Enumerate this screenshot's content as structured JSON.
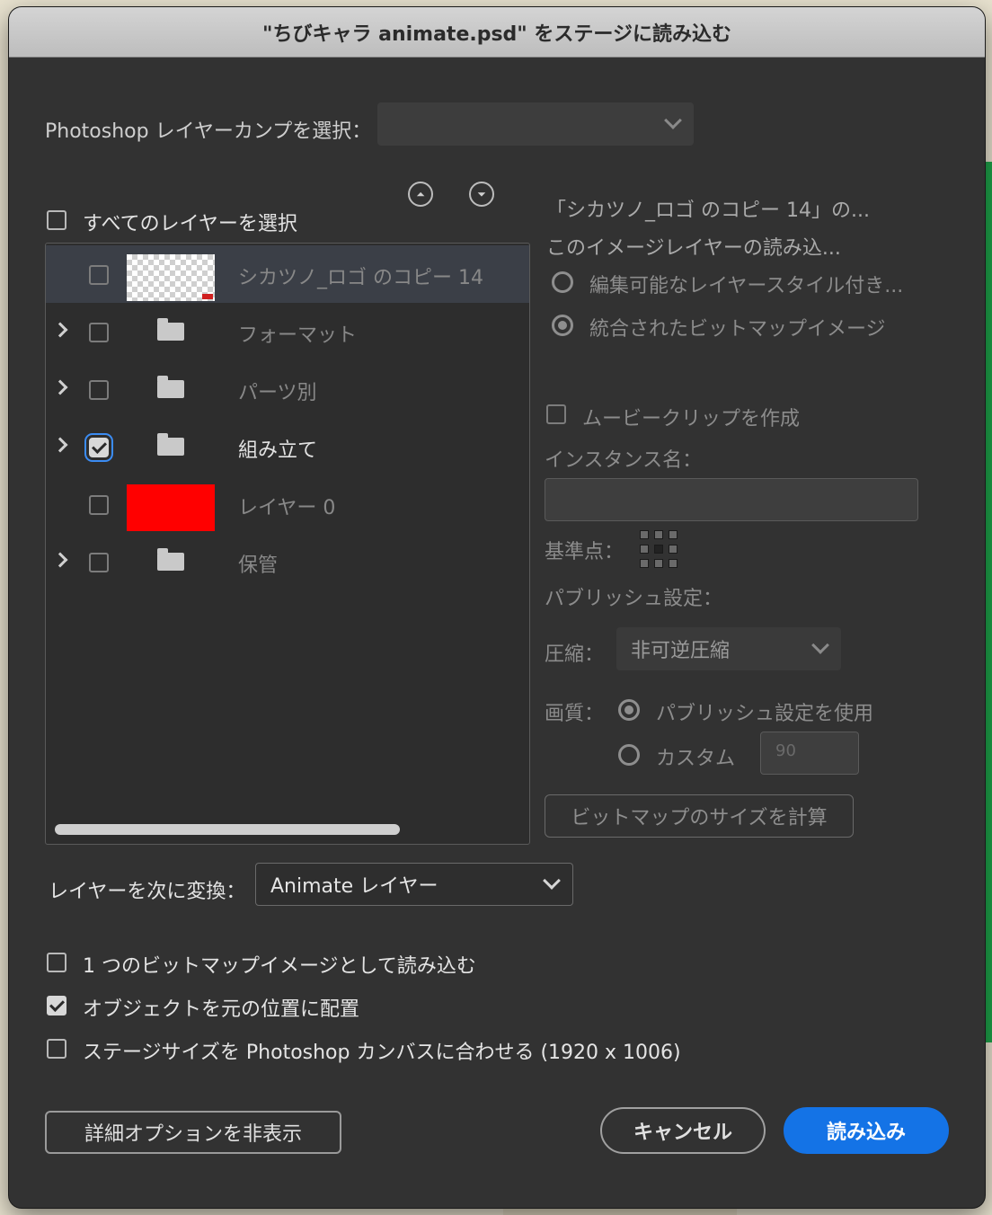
{
  "dialog": {
    "title": "\"ちびキャラ animate.psd\" をステージに読み込む"
  },
  "layer_comp": {
    "label": "Photoshop レイヤーカンプを選択：",
    "value": ""
  },
  "select_all": {
    "label": "すべてのレイヤーを選択",
    "checked": false
  },
  "layers": [
    {
      "name": "シカツノ_ロゴ のコピー 14",
      "type": "image",
      "thumbnail": "transparent-checker",
      "expandable": false,
      "checked": false,
      "selected": true
    },
    {
      "name": "フォーマット",
      "type": "folder",
      "expandable": true,
      "checked": false,
      "selected": false
    },
    {
      "name": "パーツ別",
      "type": "folder",
      "expandable": true,
      "checked": false,
      "selected": false
    },
    {
      "name": "組み立て",
      "type": "folder",
      "expandable": true,
      "checked": true,
      "selected": false
    },
    {
      "name": "レイヤー 0",
      "type": "image",
      "thumbnail": "red-fill",
      "expandable": false,
      "checked": false,
      "selected": false
    },
    {
      "name": "保管",
      "type": "folder",
      "expandable": true,
      "checked": false,
      "selected": false
    }
  ],
  "options": {
    "heading": "「シカツノ_ロゴ のコピー 14」の...",
    "subheading": "このイメージレイヤーの読み込...",
    "radio_editable": "編集可能なレイヤースタイル付き...",
    "radio_flattened": "統合されたビットマップイメージ",
    "movieclip_label": "ムービークリップを作成",
    "instance_label": "インスタンス名：",
    "instance_value": "",
    "regpoint_label": "基準点：",
    "publish_label": "パブリッシュ設定：",
    "compression_label": "圧縮：",
    "compression_value": "非可逆圧縮",
    "quality_label": "画質：",
    "quality_publish": "パブリッシュ設定を使用",
    "quality_custom": "カスタム",
    "quality_custom_value": "90",
    "calc_button": "ビットマップのサイズを計算"
  },
  "convert": {
    "label": "レイヤーを次に変換：",
    "value": "Animate レイヤー"
  },
  "bottom_options": [
    {
      "label": "1 つのビットマップイメージとして読み込む",
      "checked": false
    },
    {
      "label": "オブジェクトを元の位置に配置",
      "checked": true
    },
    {
      "label": "ステージサイズを Photoshop カンバスに合わせる (1920 x 1006)",
      "checked": false
    }
  ],
  "buttons": {
    "advanced": "詳細オプションを非表示",
    "cancel": "キャンセル",
    "import": "読み込み"
  },
  "icons": {
    "collapse_all": "collapse-all-icon",
    "expand_all": "expand-all-icon"
  }
}
